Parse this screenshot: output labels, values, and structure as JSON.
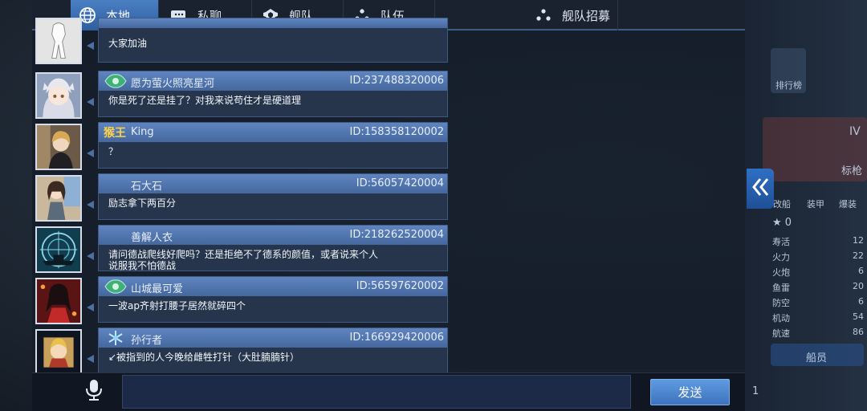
{
  "tabs": [
    {
      "label": "本地",
      "icon": "globe-icon",
      "active": true
    },
    {
      "label": "私聊",
      "icon": "chat-icon",
      "active": false
    },
    {
      "label": "舰队",
      "icon": "fleet-emblem-icon",
      "active": false
    },
    {
      "label": "队伍",
      "icon": "team-dots-icon",
      "active": false
    },
    {
      "label": "舰队招募",
      "icon": "team-dots-icon",
      "active": false
    }
  ],
  "messages": [
    {
      "sender": "",
      "id": "",
      "text": "大家加油",
      "badge": "none"
    },
    {
      "sender": "愿为萤火照亮星河",
      "id": "ID:237488320006",
      "text": "你是死了还是挂了？对我来说苟住才是硬道理",
      "badge": "emblem"
    },
    {
      "sender": "King",
      "id": "ID:158358120002",
      "text": "？",
      "badge": "text",
      "badge_text": "猴王"
    },
    {
      "sender": "石大石",
      "id": "ID:56057420004",
      "text": "励志拿下两百分",
      "badge": "none"
    },
    {
      "sender": "善解人衣",
      "id": "ID:218262520004",
      "text": "请问德战爬线好爬吗？还是拒绝不了德系的颜值，或者说来个人\n说服我不怕德战",
      "badge": "none"
    },
    {
      "sender": "山城最可爱",
      "id": "ID:56597620002",
      "text": "一波ap齐射打腰子居然就碎四个",
      "badge": "emblem"
    },
    {
      "sender": "孙行者",
      "id": "ID:166929420006",
      "text": "↙被指到的人今晚给雌牲打针（大肚腩腩针）",
      "badge": "snowflake"
    }
  ],
  "input": {
    "value": "",
    "placeholder": ""
  },
  "send_label": "发送",
  "background_panel": {
    "stats": [
      {
        "name": "寿活",
        "value": "12"
      },
      {
        "name": "火力",
        "value": "22"
      },
      {
        "name": "火炮",
        "value": "6"
      },
      {
        "name": "鱼雷",
        "value": "20"
      },
      {
        "name": "防空",
        "value": "6"
      },
      {
        "name": "机动",
        "value": "54"
      },
      {
        "name": "航速",
        "value": "86"
      }
    ],
    "star_count": "0",
    "side_labels": [
      "排行榜",
      "改船",
      "装甲",
      "爆装"
    ],
    "right_tag": "IV",
    "right_name": "标枪",
    "bottom_button": "船员",
    "bottom_number": "1"
  },
  "colors": {
    "accent": "#4a7fc3",
    "send": "#4a86d0",
    "badge_gold": "#ffd34a"
  }
}
